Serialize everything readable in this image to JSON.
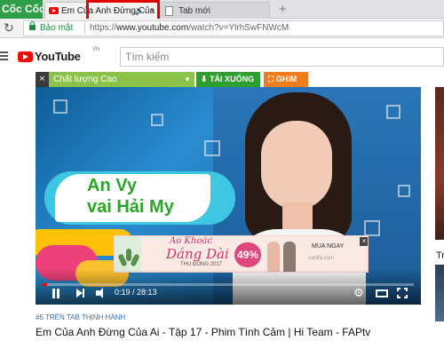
{
  "browser": {
    "logo_text": "Cốc Cốc",
    "tabs": [
      {
        "title": "Em Của Anh Đừng Của",
        "favicon": "youtube-icon",
        "audio": "speaker-icon",
        "close": "×"
      },
      {
        "title": "Tab mới",
        "favicon": "document-icon"
      }
    ],
    "new_tab_symbol": "+",
    "address": {
      "secure_label": "Bảo mật",
      "url_scheme": "https://",
      "url_host": "www.youtube.com",
      "url_path": "/watch?v=YlrhSwFNWcM"
    }
  },
  "youtube": {
    "logo_text": "YouTube",
    "region": "VN",
    "search_placeholder": "Tìm kiếm"
  },
  "extension": {
    "close": "×",
    "quality_label": "Chất lượng  Cao",
    "download_label": "TẢI XUỐNG",
    "pin_label": "GHIM",
    "accent_green": "#8bc34a",
    "download_color": "#2e9f2e",
    "pin_color": "#f07c1b"
  },
  "player": {
    "overlay_line1": "An Vy",
    "overlay_line2": "vai Hải My",
    "ad": {
      "script_line1": "Áo Khoác",
      "script_line2": "Dáng Dài",
      "season": "THU ĐÔNG 2017",
      "badge": "49%",
      "cta": "MUA NGAY",
      "site": "canifa.com",
      "close": "×"
    },
    "time_current": "0:19",
    "time_total": "28:13",
    "progress": 0.011,
    "progress_color": "#ff0000"
  },
  "video": {
    "tags": "#5 TRÊN TAB THỊNH HÀNH",
    "title": "Em Của Anh Đừng Của Ai - Tập 17 - Phim Tình Cảm | Hi Team - FAPtv"
  },
  "sidebar": {
    "partial_letter": "Tr"
  }
}
